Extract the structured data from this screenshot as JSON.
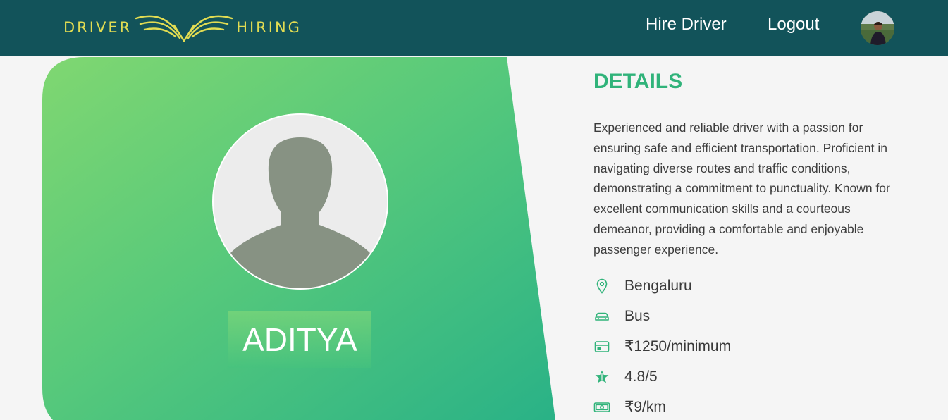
{
  "brand": {
    "left": "DRIVER",
    "right": "HIRING",
    "color": "#e2dc52"
  },
  "nav": {
    "hire_label": "Hire Driver",
    "logout_label": "Logout"
  },
  "profile": {
    "name": "ADITYA"
  },
  "details": {
    "title": "DETAILS",
    "description": "Experienced and reliable driver with a passion for ensuring safe and efficient transportation. Proficient in navigating diverse routes and traffic conditions, demonstrating a commitment to punctuality. Known for excellent communication skills and a courteous demeanor, providing a comfortable and enjoyable passenger experience.",
    "location": "Bengaluru",
    "vehicle": "Bus",
    "rate": "₹1250/minimum",
    "rating": "4.8/5",
    "per_km": "₹9/km"
  },
  "colors": {
    "navbar": "#12535a",
    "accent": "#30b37a",
    "gradient_start": "#7fd670",
    "gradient_end": "#2cb386"
  },
  "icons": [
    "map-pin-icon",
    "car-icon",
    "credit-card-icon",
    "star-icon",
    "money-icon"
  ]
}
